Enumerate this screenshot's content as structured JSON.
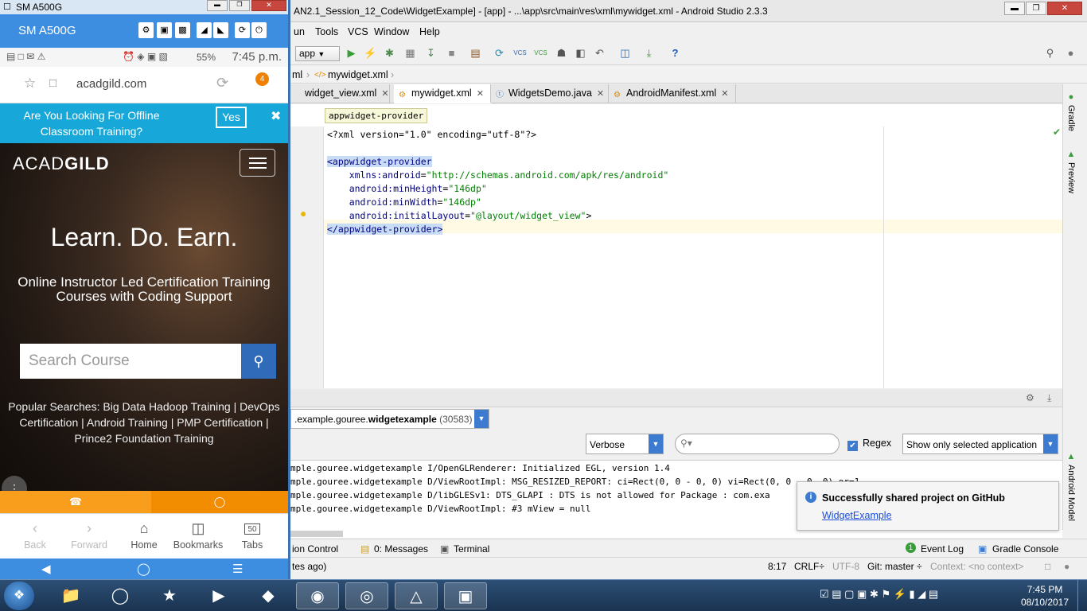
{
  "ide": {
    "title": "AN2.1_Session_12_Code\\WidgetExample] - [app] - ...\\app\\src\\main\\res\\xml\\mywidget.xml - Android Studio 2.3.3",
    "menu": [
      "un",
      "Tools",
      "VCS",
      "Window",
      "Help"
    ],
    "run_config": "app",
    "breadcrumb": [
      "ml",
      "mywidget.xml"
    ],
    "tabs": [
      {
        "label": "widget_view.xml",
        "icon": "xml-file-icon"
      },
      {
        "label": "mywidget.xml",
        "icon": "xml-file-icon",
        "active": true
      },
      {
        "label": "WidgetsDemo.java",
        "icon": "java-class-icon"
      },
      {
        "label": "AndroidManifest.xml",
        "icon": "manifest-file-icon"
      }
    ],
    "tooltip": "appwidget-provider",
    "code": {
      "line1": "<?xml version=\"1.0\" encoding=\"utf-8\"?>",
      "line3_open": "<appwidget-provider",
      "line4_attr": "xmlns:android",
      "line4_val": "\"http://schemas.android.com/apk/res/android\"",
      "line5_attr": "android:minHeight",
      "line5_val": "\"146dp\"",
      "line6_attr": "android:minWidth",
      "line6_val": "\"146dp\"",
      "line7_attr": "android:initialLayout",
      "line7_val": "\"@layout/widget_view\"",
      "line7_end": ">",
      "line8_close": "</appwidget-provider>"
    },
    "side_tools": [
      "Gradle",
      "Preview",
      "Android Model"
    ],
    "logcat": {
      "process": "...example.gouree.widgetexample (30583)",
      "process_pkg_prefix": ".example.gouree.",
      "process_pkg_bold": "widgetexample",
      "process_pid": "(30583)",
      "level": "Verbose",
      "search_placeholder": "",
      "regex_label": "Regex",
      "regex_checked": true,
      "filter": "Show only selected application",
      "lines": [
        "mple.gouree.widgetexample I/OpenGLRenderer: Initialized EGL, version 1.4",
        "mple.gouree.widgetexample D/ViewRootImpl: MSG_RESIZED_REPORT: ci=Rect(0, 0 - 0, 0) vi=Rect(0, 0 - 0, 0) or=1",
        "mple.gouree.widgetexample D/libGLESv1: DTS_GLAPI : DTS is not allowed for Package : com.exa",
        "mple.gouree.widgetexample D/ViewRootImpl: #3 mView = null"
      ]
    },
    "notification": {
      "title": "Successfully shared project on GitHub",
      "link": "WidgetExample"
    },
    "toolwindows": {
      "version_control": "ion Control",
      "messages": "0: Messages",
      "terminal": "Terminal",
      "event_log_count": "1",
      "event_log": "Event Log",
      "gradle_console": "Gradle Console"
    },
    "status": {
      "left": "tes ago)",
      "position": "8:17",
      "line_sep": "CRLF÷",
      "encoding": "UTF-8",
      "git": "Git: master ÷",
      "context": "Context: <no context>"
    }
  },
  "phone": {
    "window_title": "SM A500G",
    "device_name": "SM A500G",
    "status_battery": "55%",
    "status_time": "7:45 p.m.",
    "url": "acadgild.com",
    "tab_count": "4",
    "banner_question": "Are You Looking For Offline Classroom Training?",
    "banner_yes": "Yes",
    "logo_a": "ACAD",
    "logo_b": "GILD",
    "headline": "Learn. Do. Earn.",
    "subheadline": "Online Instructor Led Certification Training Courses with Coding Support",
    "search_placeholder": "Search Course",
    "popular": "Popular Searches: Big Data Hadoop Training | DevOps Certification | Android Training | PMP Certification | Prince2 Foundation Training",
    "nav": [
      {
        "label": "Back",
        "icon": "back-arrow-icon"
      },
      {
        "label": "Forward",
        "icon": "forward-arrow-icon"
      },
      {
        "label": "Home",
        "icon": "home-icon"
      },
      {
        "label": "Bookmarks",
        "icon": "bookmarks-icon"
      },
      {
        "label": "Tabs",
        "icon": "tabs-icon",
        "count": "50"
      }
    ]
  },
  "taskbar": {
    "time": "7:45 PM",
    "date": "08/10/2017",
    "apps": [
      "explorer-icon",
      "internet-explorer-icon",
      "star-app-icon",
      "media-player-icon",
      "paint-app-icon",
      "firefox-icon",
      "chrome-icon",
      "android-studio-icon",
      "screen-mirror-icon"
    ]
  },
  "colors": {
    "accent_blue": "#3c7bd0",
    "phone_toolbar": "#3d8ee1",
    "banner": "#17a8d9",
    "orange": "#f99d1c",
    "xml_tag": "#000080",
    "xml_value": "#008000"
  }
}
